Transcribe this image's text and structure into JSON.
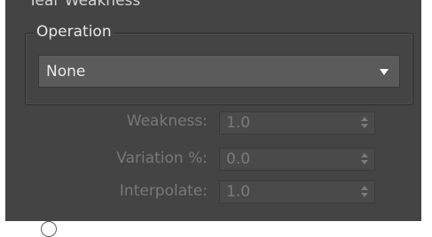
{
  "rollout": {
    "title": "Tear Weakness"
  },
  "operation": {
    "label": "Operation",
    "selected": "None"
  },
  "fields": [
    {
      "label": "Weakness:",
      "value": "1.0"
    },
    {
      "label": "Variation %:",
      "value": "0.0"
    },
    {
      "label": "Interpolate:",
      "value": "1.0"
    }
  ]
}
